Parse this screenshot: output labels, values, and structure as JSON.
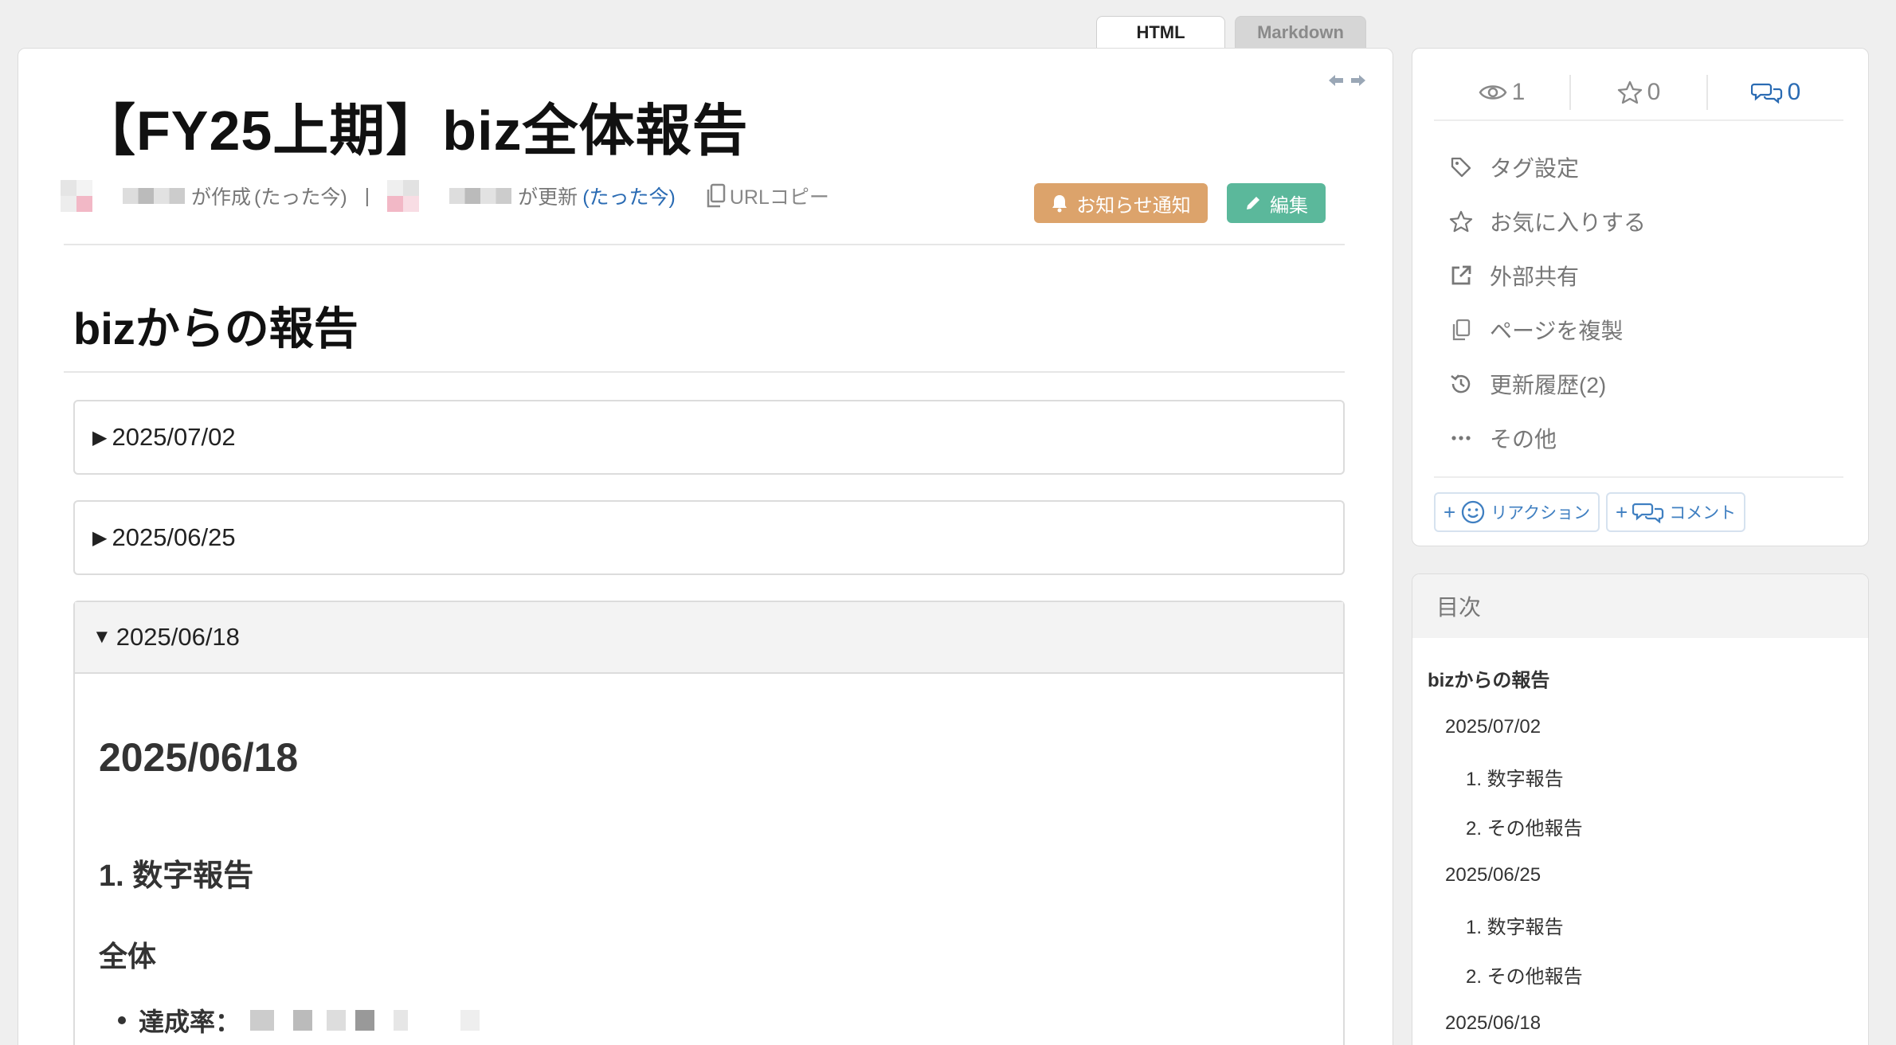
{
  "view_tabs": {
    "html": "HTML",
    "markdown": "Markdown"
  },
  "page": {
    "title": "【FY25上期】biz全体報告",
    "meta": {
      "created_suffix": "が作成",
      "created_time": "(たった今)",
      "separator": "|",
      "updated_suffix": "が更新",
      "updated_time": "(たった今)",
      "copy_url": "URLコピー"
    },
    "buttons": {
      "notify": "お知らせ通知",
      "edit": "編集"
    }
  },
  "content": {
    "heading": "bizからの報告",
    "sections": [
      {
        "summary": "2025/07/02",
        "open": false
      },
      {
        "summary": "2025/06/25",
        "open": false
      },
      {
        "summary": "2025/06/18",
        "open": true
      }
    ],
    "open_section": {
      "h2": "2025/06/18",
      "h3": "1. 数字報告",
      "h4": "全体",
      "bullet_label": "達成率："
    }
  },
  "sidebar": {
    "stats": {
      "views": "1",
      "stars": "0",
      "comments": "0"
    },
    "menu": [
      {
        "icon": "tag-icon",
        "label": "タグ設定"
      },
      {
        "icon": "star-icon",
        "label": "お気に入りする"
      },
      {
        "icon": "external-link-icon",
        "label": "外部共有"
      },
      {
        "icon": "duplicate-icon",
        "label": "ページを複製"
      },
      {
        "icon": "history-icon",
        "label": "更新履歴(2)"
      },
      {
        "icon": "more-icon",
        "label": "その他"
      }
    ],
    "chips": {
      "reaction": "リアクション",
      "comment": "コメント",
      "plus": "+"
    }
  },
  "toc": {
    "title": "目次",
    "items": [
      {
        "label": "bizからの報告",
        "level": 0
      },
      {
        "label": "2025/07/02",
        "level": 1
      },
      {
        "label": "1. 数字報告",
        "level": 2
      },
      {
        "label": "2. その他報告",
        "level": 2
      },
      {
        "label": "2025/06/25",
        "level": 1
      },
      {
        "label": "1. 数字報告",
        "level": 2
      },
      {
        "label": "2. その他報告",
        "level": 2
      },
      {
        "label": "2025/06/18",
        "level": 1
      }
    ]
  },
  "colors": {
    "notify_button": "#dca36b",
    "edit_button": "#5bb89b",
    "link": "#2a6bb3"
  }
}
